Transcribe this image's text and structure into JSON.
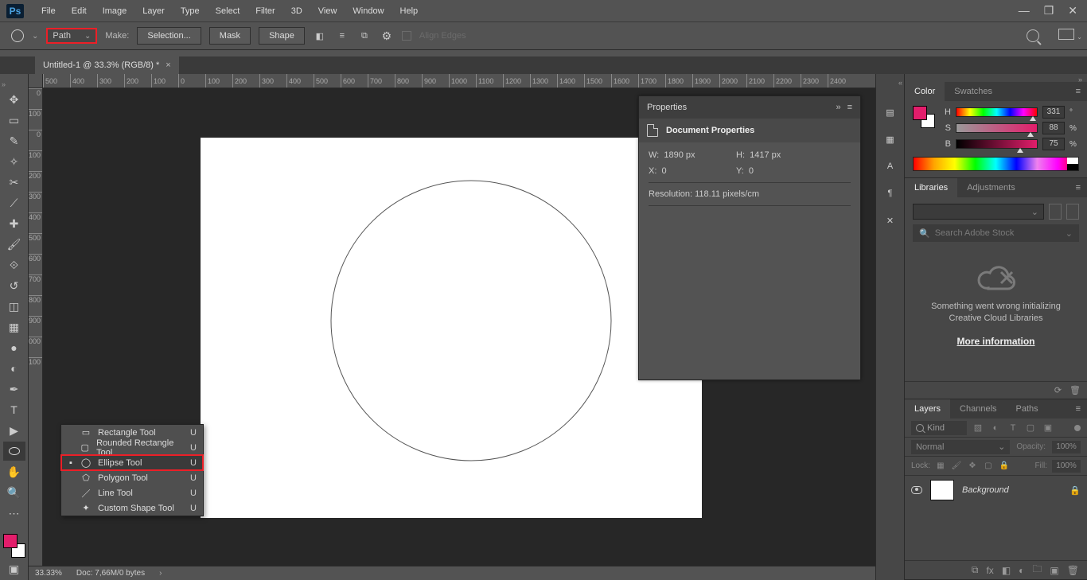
{
  "menubar": [
    "File",
    "Edit",
    "Image",
    "Layer",
    "Type",
    "Select",
    "Filter",
    "3D",
    "View",
    "Window",
    "Help"
  ],
  "options": {
    "mode": "Path",
    "make_label": "Make:",
    "selection_btn": "Selection...",
    "mask_btn": "Mask",
    "shape_btn": "Shape",
    "align_label": "Align Edges"
  },
  "document": {
    "tab_title": "Untitled-1 @ 33.3% (RGB/8) *"
  },
  "ruler_h": [
    "500",
    "400",
    "300",
    "200",
    "100",
    "0",
    "100",
    "200",
    "300",
    "400",
    "500",
    "600",
    "700",
    "800",
    "900",
    "1000",
    "1100",
    "1200",
    "1300",
    "1400",
    "1500",
    "1600",
    "1700",
    "1800",
    "1900",
    "2000",
    "2100",
    "2200",
    "2300",
    "2400"
  ],
  "ruler_v": [
    "0",
    "100",
    "0",
    "100",
    "200",
    "300",
    "400",
    "500",
    "600",
    "700",
    "800",
    "900",
    "000",
    "100"
  ],
  "flyout": {
    "items": [
      {
        "label": "Rectangle Tool",
        "key": "U",
        "icon": "rect"
      },
      {
        "label": "Rounded Rectangle Tool",
        "key": "U",
        "icon": "rrect"
      },
      {
        "label": "Ellipse Tool",
        "key": "U",
        "icon": "ellipse",
        "selected": true
      },
      {
        "label": "Polygon Tool",
        "key": "U",
        "icon": "poly"
      },
      {
        "label": "Line Tool",
        "key": "U",
        "icon": "line"
      },
      {
        "label": "Custom Shape Tool",
        "key": "U",
        "icon": "custom"
      }
    ]
  },
  "status": {
    "zoom": "33.33%",
    "doc_info": "Doc: 7,66M/0 bytes"
  },
  "properties": {
    "panel_title": "Properties",
    "sub_title": "Document Properties",
    "w_label": "W:",
    "w_val": "1890 px",
    "h_label": "H:",
    "h_val": "1417 px",
    "x_label": "X:",
    "x_val": "0",
    "y_label": "Y:",
    "y_val": "0",
    "res_label": "Resolution:",
    "res_val": "118.11 pixels/cm"
  },
  "color_panel": {
    "tabs": [
      "Color",
      "Swatches"
    ],
    "h": {
      "label": "H",
      "val": "331",
      "unit": "°",
      "pos": 91
    },
    "s": {
      "label": "S",
      "val": "88",
      "unit": "%",
      "pos": 88
    },
    "b": {
      "label": "B",
      "val": "75",
      "unit": "%",
      "pos": 75
    }
  },
  "libraries_panel": {
    "tabs": [
      "Libraries",
      "Adjustments"
    ],
    "search_placeholder": "Search Adobe Stock",
    "error_line1": "Something went wrong initializing",
    "error_line2": "Creative Cloud Libraries",
    "link": "More information"
  },
  "layers_panel": {
    "tabs": [
      "Layers",
      "Channels",
      "Paths"
    ],
    "kind": "Kind",
    "mode": "Normal",
    "opacity_label": "Opacity:",
    "opacity_val": "100%",
    "lock_label": "Lock:",
    "fill_label": "Fill:",
    "fill_val": "100%",
    "layer_name": "Background"
  }
}
